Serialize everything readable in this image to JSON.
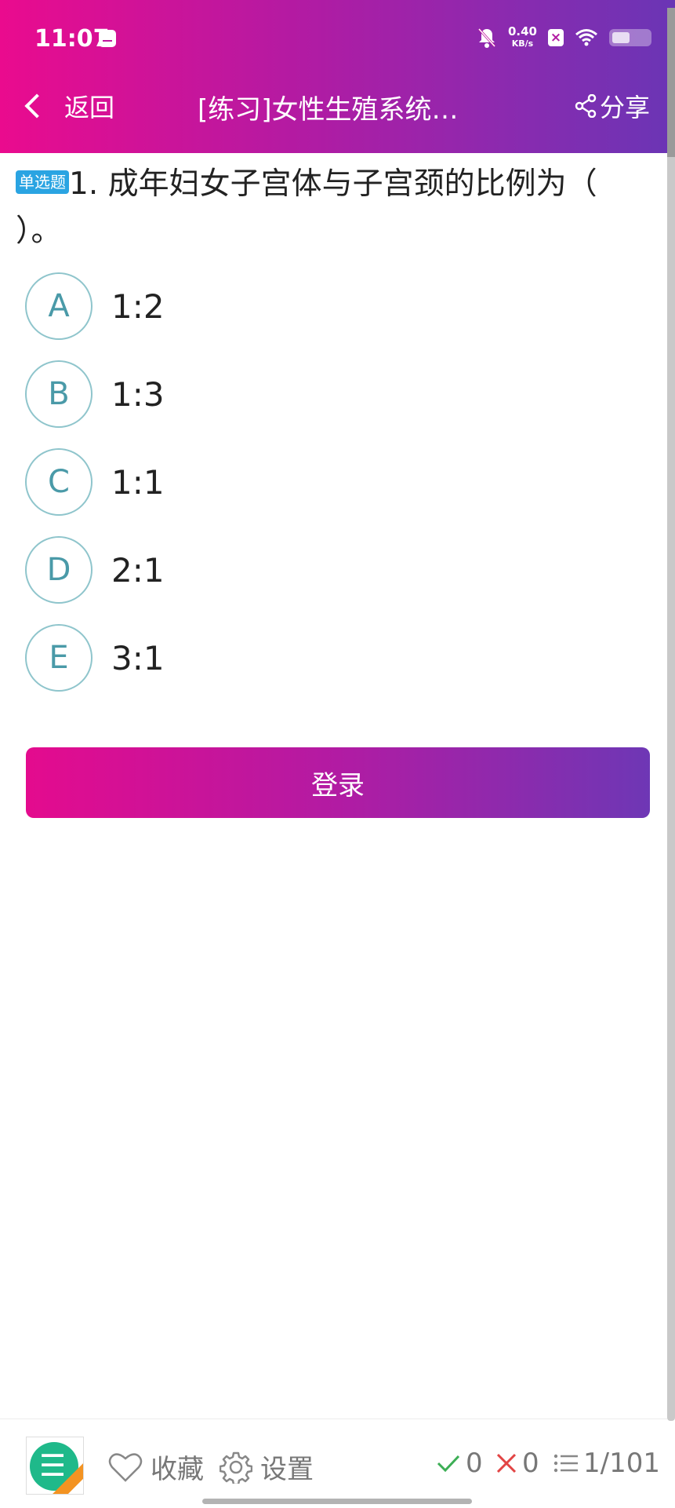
{
  "status_bar": {
    "time": "11:07",
    "net_speed": "0.40",
    "net_unit": "KB/s"
  },
  "nav": {
    "back_label": "返回",
    "title": "[练习]女性生殖系统…",
    "share_label": "分享"
  },
  "question": {
    "type_badge": "单选题",
    "text": "1. 成年妇女子宫体与子宫颈的比例为（ ）。"
  },
  "options": [
    {
      "letter": "A",
      "text": "1:2"
    },
    {
      "letter": "B",
      "text": "1:3"
    },
    {
      "letter": "C",
      "text": "1:1"
    },
    {
      "letter": "D",
      "text": "2:1"
    },
    {
      "letter": "E",
      "text": "3:1"
    }
  ],
  "login_button": "登录",
  "bottom_bar": {
    "favorite_label": "收藏",
    "settings_label": "设置",
    "correct_count": "0",
    "wrong_count": "0",
    "progress": "1/101"
  },
  "colors": {
    "brand_start": "#ea0b8e",
    "brand_end": "#6a35b5",
    "option_border": "#8fc5cc",
    "badge": "#2aa4e2"
  }
}
